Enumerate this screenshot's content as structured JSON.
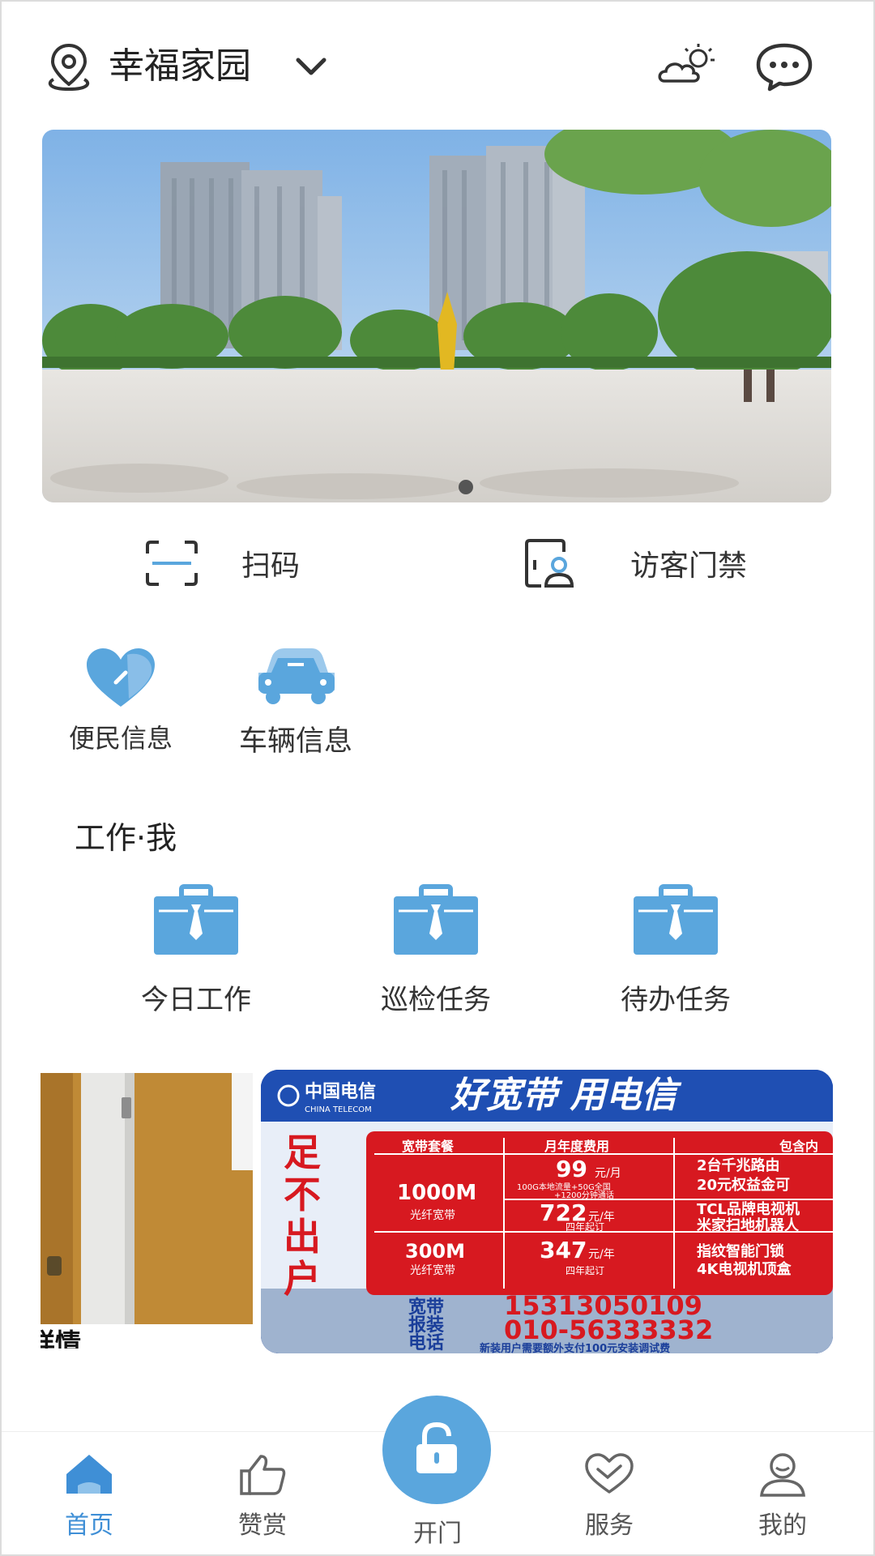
{
  "header": {
    "community": "幸福家园",
    "icons": [
      "location-pin-icon",
      "chevron-down-icon",
      "weather-cloud-sun-icon",
      "message-bubble-icon"
    ]
  },
  "banner": {
    "slides": 1,
    "active_index": 0
  },
  "quick_actions": [
    {
      "label": "扫码",
      "icon": "scan-icon"
    },
    {
      "label": "访客门禁",
      "icon": "visitor-access-icon"
    }
  ],
  "info_items": [
    {
      "label": "便民信息",
      "icon": "heart-info-icon"
    },
    {
      "label": "车辆信息",
      "icon": "car-icon"
    }
  ],
  "work": {
    "title": "工作·我",
    "items": [
      {
        "label": "今日工作",
        "icon": "briefcase-icon"
      },
      {
        "label": "巡检任务",
        "icon": "briefcase-icon"
      },
      {
        "label": "待办任务",
        "icon": "briefcase-icon"
      }
    ]
  },
  "ads": {
    "left_caption": "详情",
    "right": {
      "brand": "中国电信",
      "brand_en": "CHINA TELECOM",
      "slogan": "好宽带 用电信",
      "side_text": [
        "足",
        "不",
        "出",
        "户"
      ],
      "table_headers": [
        "宽带套餐",
        "月年度费用",
        "包含内"
      ],
      "rows": [
        {
          "plan": "1000M",
          "plan_sub": "光纤宽带",
          "price1": "99",
          "unit1": "元/月",
          "note1": "100G本地流量+50G全国",
          "note1b": "+1200分钟通话",
          "price2": "722",
          "unit2": "元/年",
          "note2": "四年起订",
          "inc1": "2台千兆路由",
          "inc2": "20元权益金可",
          "inc3": "TCL品牌电视机",
          "inc4": "米家扫地机器人"
        },
        {
          "plan": "300M",
          "plan_sub": "光纤宽带",
          "price3": "347",
          "unit3": "元/年",
          "note3": "四年起订",
          "inc5": "指纹智能门锁",
          "inc6": "4K电视机顶盒"
        }
      ],
      "hotline_label": [
        "宽带",
        "报装",
        "电话"
      ],
      "phone1": "15313050109",
      "phone2": "010-56333332",
      "footnote": "新装用户需要额外支付100元安装调试费"
    }
  },
  "bottom_nav": [
    {
      "label": "首页",
      "icon": "home-icon",
      "active": true
    },
    {
      "label": "赞赏",
      "icon": "thumbs-up-icon",
      "active": false
    },
    {
      "label": "开门",
      "icon": "unlock-icon",
      "active": false
    },
    {
      "label": "服务",
      "icon": "heart-service-icon",
      "active": false
    },
    {
      "label": "我的",
      "icon": "user-icon",
      "active": false
    }
  ],
  "colors": {
    "accent": "#5aa6dd",
    "accent_dark": "#3f8fd6",
    "ad_red": "#d71920",
    "ad_blue": "#1a3e9a"
  }
}
